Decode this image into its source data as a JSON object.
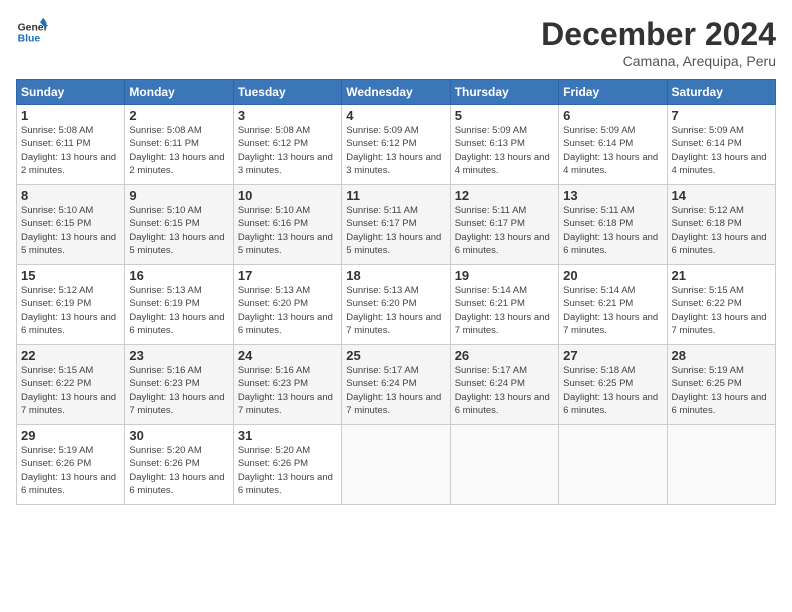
{
  "header": {
    "logo_line1": "General",
    "logo_line2": "Blue",
    "month": "December 2024",
    "location": "Camana, Arequipa, Peru"
  },
  "weekdays": [
    "Sunday",
    "Monday",
    "Tuesday",
    "Wednesday",
    "Thursday",
    "Friday",
    "Saturday"
  ],
  "weeks": [
    [
      {
        "day": "1",
        "sunrise": "5:08 AM",
        "sunset": "6:11 PM",
        "daylight": "13 hours and 2 minutes."
      },
      {
        "day": "2",
        "sunrise": "5:08 AM",
        "sunset": "6:11 PM",
        "daylight": "13 hours and 2 minutes."
      },
      {
        "day": "3",
        "sunrise": "5:08 AM",
        "sunset": "6:12 PM",
        "daylight": "13 hours and 3 minutes."
      },
      {
        "day": "4",
        "sunrise": "5:09 AM",
        "sunset": "6:12 PM",
        "daylight": "13 hours and 3 minutes."
      },
      {
        "day": "5",
        "sunrise": "5:09 AM",
        "sunset": "6:13 PM",
        "daylight": "13 hours and 4 minutes."
      },
      {
        "day": "6",
        "sunrise": "5:09 AM",
        "sunset": "6:14 PM",
        "daylight": "13 hours and 4 minutes."
      },
      {
        "day": "7",
        "sunrise": "5:09 AM",
        "sunset": "6:14 PM",
        "daylight": "13 hours and 4 minutes."
      }
    ],
    [
      {
        "day": "8",
        "sunrise": "5:10 AM",
        "sunset": "6:15 PM",
        "daylight": "13 hours and 5 minutes."
      },
      {
        "day": "9",
        "sunrise": "5:10 AM",
        "sunset": "6:15 PM",
        "daylight": "13 hours and 5 minutes."
      },
      {
        "day": "10",
        "sunrise": "5:10 AM",
        "sunset": "6:16 PM",
        "daylight": "13 hours and 5 minutes."
      },
      {
        "day": "11",
        "sunrise": "5:11 AM",
        "sunset": "6:17 PM",
        "daylight": "13 hours and 5 minutes."
      },
      {
        "day": "12",
        "sunrise": "5:11 AM",
        "sunset": "6:17 PM",
        "daylight": "13 hours and 6 minutes."
      },
      {
        "day": "13",
        "sunrise": "5:11 AM",
        "sunset": "6:18 PM",
        "daylight": "13 hours and 6 minutes."
      },
      {
        "day": "14",
        "sunrise": "5:12 AM",
        "sunset": "6:18 PM",
        "daylight": "13 hours and 6 minutes."
      }
    ],
    [
      {
        "day": "15",
        "sunrise": "5:12 AM",
        "sunset": "6:19 PM",
        "daylight": "13 hours and 6 minutes."
      },
      {
        "day": "16",
        "sunrise": "5:13 AM",
        "sunset": "6:19 PM",
        "daylight": "13 hours and 6 minutes."
      },
      {
        "day": "17",
        "sunrise": "5:13 AM",
        "sunset": "6:20 PM",
        "daylight": "13 hours and 6 minutes."
      },
      {
        "day": "18",
        "sunrise": "5:13 AM",
        "sunset": "6:20 PM",
        "daylight": "13 hours and 7 minutes."
      },
      {
        "day": "19",
        "sunrise": "5:14 AM",
        "sunset": "6:21 PM",
        "daylight": "13 hours and 7 minutes."
      },
      {
        "day": "20",
        "sunrise": "5:14 AM",
        "sunset": "6:21 PM",
        "daylight": "13 hours and 7 minutes."
      },
      {
        "day": "21",
        "sunrise": "5:15 AM",
        "sunset": "6:22 PM",
        "daylight": "13 hours and 7 minutes."
      }
    ],
    [
      {
        "day": "22",
        "sunrise": "5:15 AM",
        "sunset": "6:22 PM",
        "daylight": "13 hours and 7 minutes."
      },
      {
        "day": "23",
        "sunrise": "5:16 AM",
        "sunset": "6:23 PM",
        "daylight": "13 hours and 7 minutes."
      },
      {
        "day": "24",
        "sunrise": "5:16 AM",
        "sunset": "6:23 PM",
        "daylight": "13 hours and 7 minutes."
      },
      {
        "day": "25",
        "sunrise": "5:17 AM",
        "sunset": "6:24 PM",
        "daylight": "13 hours and 7 minutes."
      },
      {
        "day": "26",
        "sunrise": "5:17 AM",
        "sunset": "6:24 PM",
        "daylight": "13 hours and 6 minutes."
      },
      {
        "day": "27",
        "sunrise": "5:18 AM",
        "sunset": "6:25 PM",
        "daylight": "13 hours and 6 minutes."
      },
      {
        "day": "28",
        "sunrise": "5:19 AM",
        "sunset": "6:25 PM",
        "daylight": "13 hours and 6 minutes."
      }
    ],
    [
      {
        "day": "29",
        "sunrise": "5:19 AM",
        "sunset": "6:26 PM",
        "daylight": "13 hours and 6 minutes."
      },
      {
        "day": "30",
        "sunrise": "5:20 AM",
        "sunset": "6:26 PM",
        "daylight": "13 hours and 6 minutes."
      },
      {
        "day": "31",
        "sunrise": "5:20 AM",
        "sunset": "6:26 PM",
        "daylight": "13 hours and 6 minutes."
      },
      null,
      null,
      null,
      null
    ]
  ]
}
